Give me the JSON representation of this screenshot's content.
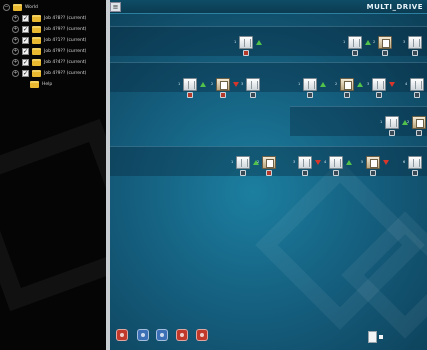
{
  "sidebar": {
    "root_label": "World",
    "jobs": [
      {
        "label": "Job 4?8?? (current)"
      },
      {
        "label": "Job 4?9?? (current)"
      },
      {
        "label": "Job 4?1?? (current)"
      },
      {
        "label": "Job 4?9?? (current)"
      },
      {
        "label": "Job 4?4?? (current)"
      },
      {
        "label": "Job 4?9?? (current)"
      }
    ],
    "help_label": "Help"
  },
  "header": {
    "menu_glyph": "≡",
    "title": "MULTI_DRIVE"
  },
  "main": {
    "side_caption": "",
    "strips": [
      {
        "caption": ""
      },
      {
        "caption": ""
      },
      {
        "caption": ""
      },
      {
        "caption": ""
      },
      {
        "caption": ""
      },
      {
        "caption": ""
      }
    ],
    "nodes": [
      {
        "index": "1",
        "style": "silver",
        "badge": "red",
        "status": "up"
      },
      {
        "index": "1",
        "style": "silver",
        "badge": "none",
        "status": "up"
      },
      {
        "index": "2",
        "style": "gold",
        "badge": "none",
        "status": "none"
      },
      {
        "index": "3",
        "style": "silver",
        "badge": "none",
        "status": "none"
      },
      {
        "index": "1",
        "style": "silver",
        "badge": "red",
        "status": "up"
      },
      {
        "index": "2",
        "style": "gold",
        "badge": "red",
        "status": "down"
      },
      {
        "index": "3",
        "style": "silver",
        "badge": "none",
        "status": "none"
      },
      {
        "index": "1",
        "style": "silver",
        "badge": "none",
        "status": "up"
      },
      {
        "index": "2",
        "style": "gold",
        "badge": "none",
        "status": "up"
      },
      {
        "index": "3",
        "style": "silver",
        "badge": "none",
        "status": "down"
      },
      {
        "index": "4",
        "style": "silver",
        "badge": "none",
        "status": "up"
      },
      {
        "index": "1",
        "style": "silver",
        "badge": "none",
        "status": "up"
      },
      {
        "index": "2",
        "style": "gold",
        "badge": "none",
        "status": "none"
      },
      {
        "index": "1",
        "style": "silver",
        "badge": "none",
        "status": "up"
      },
      {
        "index": "2",
        "style": "gold",
        "badge": "red",
        "status": "none"
      },
      {
        "index": "3",
        "style": "silver",
        "badge": "none",
        "status": "down"
      },
      {
        "index": "4",
        "style": "silver",
        "badge": "none",
        "status": "up"
      },
      {
        "index": "5",
        "style": "gold",
        "badge": "none",
        "status": "down"
      },
      {
        "index": "6",
        "style": "silver",
        "badge": "none",
        "status": "none"
      }
    ]
  },
  "toolbar": {
    "tools": [
      {
        "icon": "exit-icon",
        "color": "#c0392b"
      },
      {
        "icon": "layout-icon",
        "color": "#3b6fb6"
      },
      {
        "icon": "refresh-icon",
        "color": "#3b6fb6"
      },
      {
        "icon": "tag-icon",
        "color": "#c0392b"
      },
      {
        "icon": "settings-icon",
        "color": "#c0392b"
      }
    ],
    "stat_label_1": "",
    "stat_label_2": "",
    "stat_value_1": ""
  },
  "colors": {
    "status_up": "#52c24a",
    "status_down": "#d8362a",
    "folder": "#e8b830",
    "canvas": "#155f7f"
  }
}
